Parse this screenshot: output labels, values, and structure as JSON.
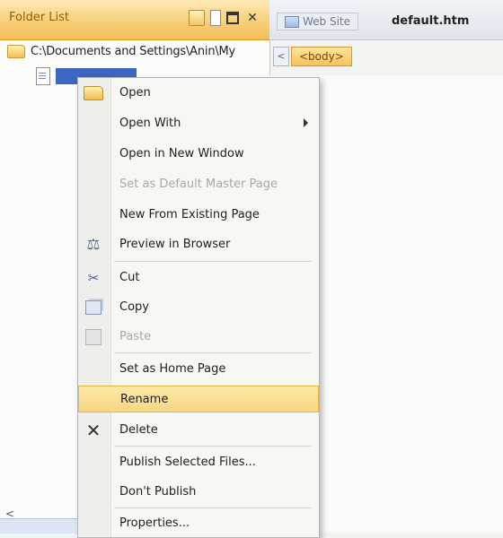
{
  "folder_list": {
    "title": "Folder List",
    "root_path": "C:\\Documents and Settings\\Anin\\My",
    "scroll_left_glyph": "<"
  },
  "editor": {
    "website_tab": "Web Site",
    "file_tab": "default.htm",
    "tag_nav_glyph": "<",
    "body_tag": "<body>"
  },
  "context_menu": {
    "items": [
      {
        "label": "Open",
        "icon": "open-folder-icon",
        "enabled": true
      },
      {
        "label": "Open With",
        "submenu": true,
        "enabled": true
      },
      {
        "label": "Open in New Window",
        "enabled": true
      },
      {
        "label": "Set as Default Master Page",
        "enabled": false
      },
      {
        "label": "New From Existing Page",
        "enabled": true
      },
      {
        "label": "Preview in Browser",
        "icon": "preview-icon",
        "enabled": true
      },
      {
        "label": "Cut",
        "icon": "cut-icon",
        "enabled": true
      },
      {
        "label": "Copy",
        "icon": "copy-icon",
        "enabled": true
      },
      {
        "label": "Paste",
        "icon": "paste-icon",
        "enabled": false
      },
      {
        "label": "Set as Home Page",
        "enabled": true
      },
      {
        "label": "Rename",
        "highlighted": true,
        "enabled": true
      },
      {
        "label": "Delete",
        "icon": "delete-icon",
        "enabled": true
      },
      {
        "label": "Publish Selected Files...",
        "enabled": true
      },
      {
        "label": "Don't Publish",
        "enabled": true
      },
      {
        "label": "Properties...",
        "enabled": true
      }
    ]
  },
  "colors": {
    "pane_header": "#f7cf78",
    "selection": "#3b66c2",
    "menu_highlight": "#fde9a8"
  }
}
